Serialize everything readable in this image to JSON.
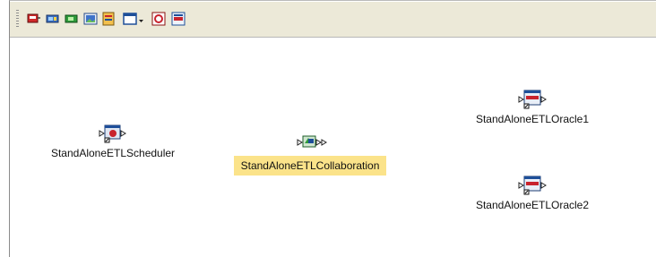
{
  "toolbar": {
    "buttons": [
      {
        "icon": "add-component-icon"
      },
      {
        "icon": "connect-icon"
      },
      {
        "icon": "link-icon"
      },
      {
        "icon": "image-icon"
      },
      {
        "icon": "properties-icon"
      },
      {
        "icon": "window-dropdown-icon"
      },
      {
        "icon": "run-icon"
      },
      {
        "icon": "oracle-icon"
      }
    ]
  },
  "canvas": {
    "nodes": [
      {
        "id": "scheduler",
        "label": "StandAloneETLScheduler",
        "selected": false
      },
      {
        "id": "collaboration",
        "label": "StandAloneETLCollaboration",
        "selected": true
      },
      {
        "id": "oracle1",
        "label": "StandAloneETLOracle1",
        "selected": false
      },
      {
        "id": "oracle2",
        "label": "StandAloneETLOracle2",
        "selected": false
      }
    ]
  },
  "colors": {
    "selection": "#fbe38a",
    "toolbar": "#ece9d8",
    "accent_red": "#c8232d",
    "accent_blue": "#1e4f99"
  }
}
